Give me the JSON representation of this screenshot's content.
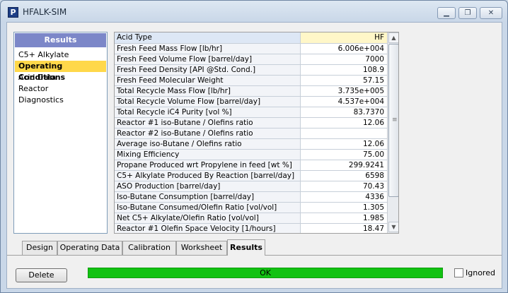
{
  "window": {
    "title": "HFALK-SIM",
    "app_icon_letter": "P",
    "controls": {
      "minimize": "▁",
      "maximize": "❐",
      "close": "✕"
    }
  },
  "nav": {
    "header": "Results",
    "items": [
      {
        "label": "C5+ Alkylate",
        "selected": false
      },
      {
        "label": "Operating Conditions",
        "selected": true
      },
      {
        "label": "Acid Data",
        "selected": false
      },
      {
        "label": "Reactor",
        "selected": false
      },
      {
        "label": "Diagnostics",
        "selected": false
      }
    ]
  },
  "grid": {
    "rows": [
      {
        "label": "Acid Type",
        "value": "HF"
      },
      {
        "label": "Fresh Feed Mass Flow [lb/hr]",
        "value": "6.006e+004"
      },
      {
        "label": "Fresh Feed Volume Flow [barrel/day]",
        "value": "7000"
      },
      {
        "label": "Fresh Feed Density [API @Std. Cond.]",
        "value": "108.9"
      },
      {
        "label": "Fresh Feed Molecular Weight",
        "value": "57.15"
      },
      {
        "label": "Total Recycle Mass Flow [lb/hr]",
        "value": "3.735e+005"
      },
      {
        "label": "Total Recycle Volume Flow [barrel/day]",
        "value": "4.537e+004"
      },
      {
        "label": "Total Recycle iC4 Purity [vol %]",
        "value": "83.7370"
      },
      {
        "label": "Reactor #1 iso-Butane / Olefins ratio",
        "value": "12.06"
      },
      {
        "label": "Reactor #2 iso-Butane / Olefins ratio",
        "value": ""
      },
      {
        "label": "Average iso-Butane / Olefins ratio",
        "value": "12.06"
      },
      {
        "label": "Mixing Efficiency",
        "value": "75.00"
      },
      {
        "label": "Propane Produced wrt Propylene in feed [wt %]",
        "value": "299.9241"
      },
      {
        "label": "C5+ Alkylate Produced By Reaction [barrel/day]",
        "value": "6598"
      },
      {
        "label": "ASO Production [barrel/day]",
        "value": "70.43"
      },
      {
        "label": "Iso-Butane Consumption [barrel/day]",
        "value": "4336"
      },
      {
        "label": "Iso-Butane Consumed/Olefin Ratio [vol/vol]",
        "value": "1.305"
      },
      {
        "label": "Net C5+ Alkylate/Olefin Ratio [vol/vol]",
        "value": "1.985"
      },
      {
        "label": "Reactor #1 Olefin Space Velocity [1/hours]",
        "value": "18.47"
      }
    ],
    "scroll": {
      "up": "▲",
      "down": "▼",
      "grip": "≡"
    }
  },
  "tabs": [
    {
      "label": "Design",
      "active": false
    },
    {
      "label": "Operating Data",
      "active": false
    },
    {
      "label": "Calibration",
      "active": false
    },
    {
      "label": "Worksheet",
      "active": false
    },
    {
      "label": "Results",
      "active": true
    }
  ],
  "footer": {
    "delete_label": "Delete",
    "status_text": "OK",
    "status_color": "#12c212",
    "ignored_label": "Ignored",
    "ignored_checked": false
  }
}
